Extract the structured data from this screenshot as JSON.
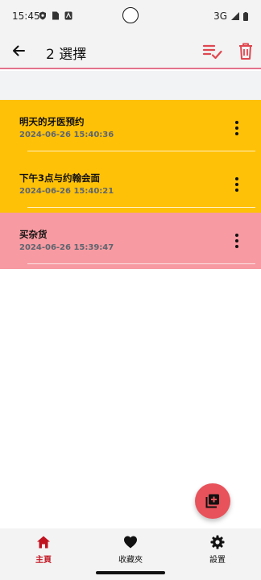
{
  "status_bar": {
    "time": "15:45",
    "network": "3G"
  },
  "app_bar": {
    "title": "2 選擇",
    "icons": [
      "back-arrow-icon",
      "select-all-icon",
      "delete-icon"
    ],
    "accent_color": "#e0464f",
    "underline_color": "#e2728c"
  },
  "notes": [
    {
      "title": "明天的牙医预约",
      "date": "2024-06-26 15:40:36",
      "color": "#ffc107"
    },
    {
      "title": "下午3点与约翰会面",
      "date": "2024-06-26 15:40:21",
      "color": "#ffc107"
    },
    {
      "title": "买杂货",
      "date": "2024-06-26 15:39:47",
      "color": "#f79aa1"
    }
  ],
  "fab": {
    "icon": "add-note-icon",
    "color": "#e8525a"
  },
  "bottom_nav": {
    "items": [
      {
        "label": "主頁",
        "icon": "home-icon",
        "active": true
      },
      {
        "label": "收藏夾",
        "icon": "heart-icon",
        "active": false
      },
      {
        "label": "設置",
        "icon": "gear-icon",
        "active": false
      }
    ],
    "active_color": "#c1121f"
  }
}
